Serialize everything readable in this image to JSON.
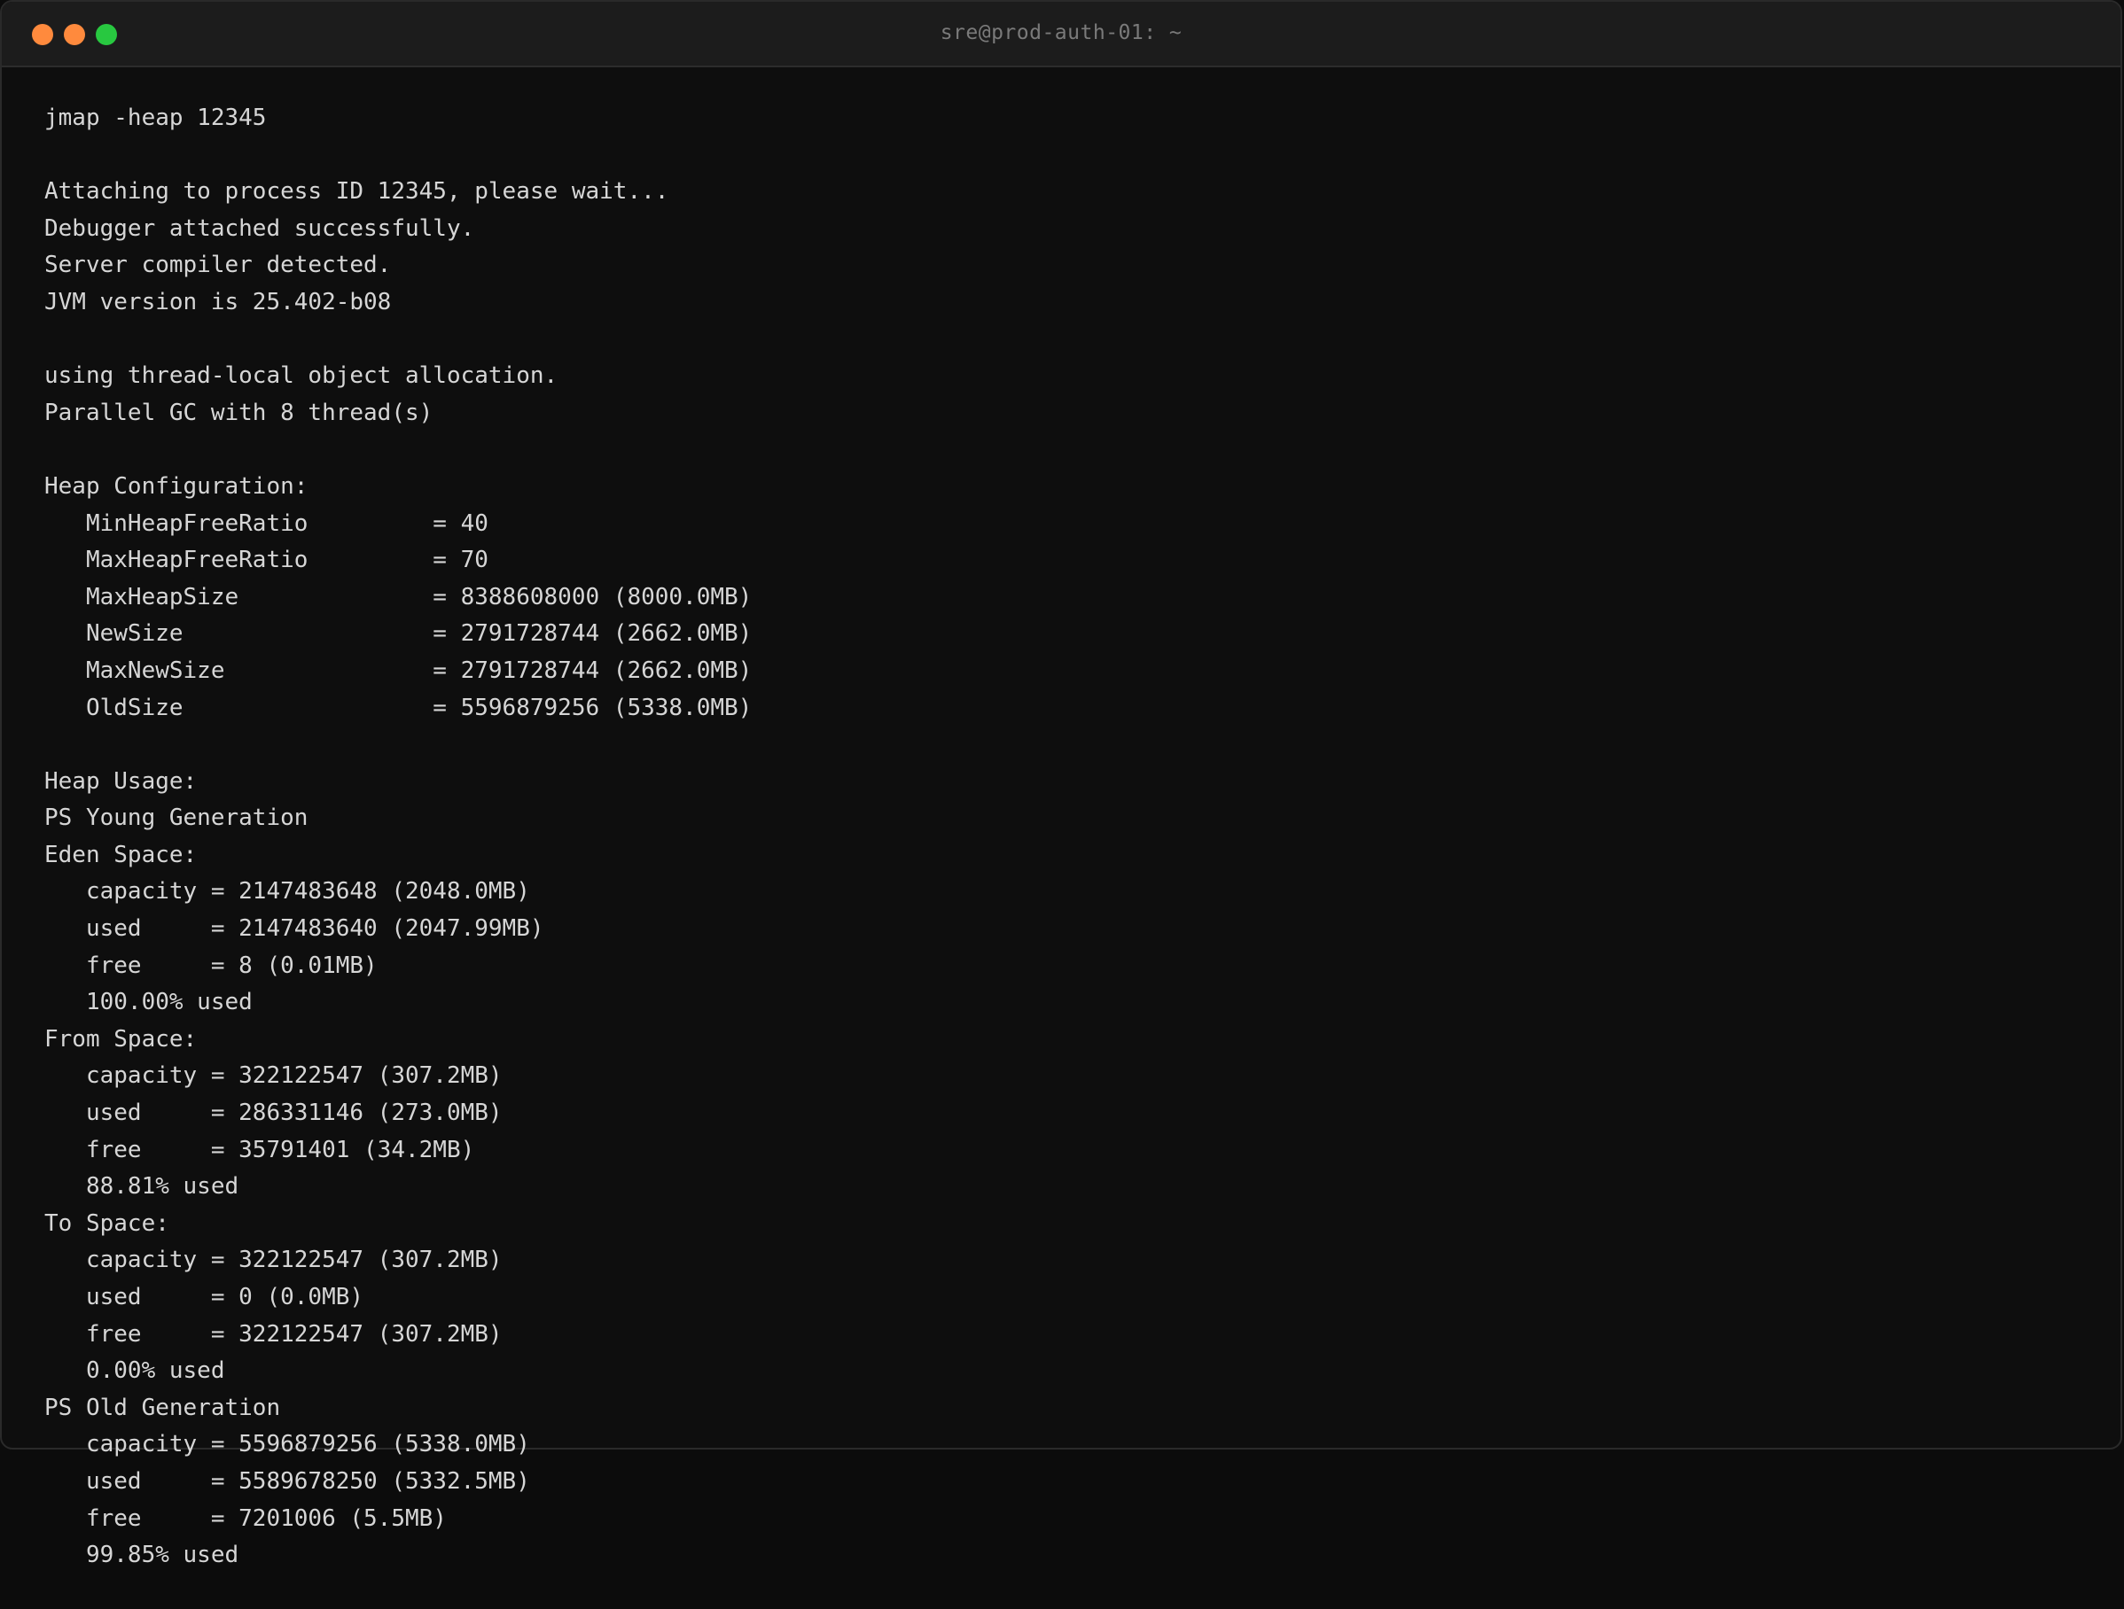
{
  "window": {
    "title": "sre@prod-auth-01: ~"
  },
  "terminal": {
    "lines": [
      "jmap -heap 12345",
      "",
      "Attaching to process ID 12345, please wait...",
      "Debugger attached successfully.",
      "Server compiler detected.",
      "JVM version is 25.402-b08",
      "",
      "using thread-local object allocation.",
      "Parallel GC with 8 thread(s)",
      "",
      "Heap Configuration:",
      "   MinHeapFreeRatio         = 40",
      "   MaxHeapFreeRatio         = 70",
      "   MaxHeapSize              = 8388608000 (8000.0MB)",
      "   NewSize                  = 2791728744 (2662.0MB)",
      "   MaxNewSize               = 2791728744 (2662.0MB)",
      "   OldSize                  = 5596879256 (5338.0MB)",
      "",
      "Heap Usage:",
      "PS Young Generation",
      "Eden Space:",
      "   capacity = 2147483648 (2048.0MB)",
      "   used     = 2147483640 (2047.99MB)",
      "   free     = 8 (0.01MB)",
      "   100.00% used",
      "From Space:",
      "   capacity = 322122547 (307.2MB)",
      "   used     = 286331146 (273.0MB)",
      "   free     = 35791401 (34.2MB)",
      "   88.81% used",
      "To Space:",
      "   capacity = 322122547 (307.2MB)",
      "   used     = 0 (0.0MB)",
      "   free     = 322122547 (307.2MB)",
      "   0.00% used",
      "PS Old Generation",
      "   capacity = 5596879256 (5338.0MB)",
      "   used     = 5589678250 (5332.5MB)",
      "   free     = 7201006 (5.5MB)",
      "   99.85% used"
    ]
  },
  "colors": {
    "background": "#0e0e0e",
    "titlebar": "#1c1c1c",
    "text": "#d6d6d6",
    "title_text": "#7a7a7a",
    "close_button": "#ff8a3d",
    "minimize_button": "#ff8a3d",
    "maximize_button": "#28c840"
  }
}
